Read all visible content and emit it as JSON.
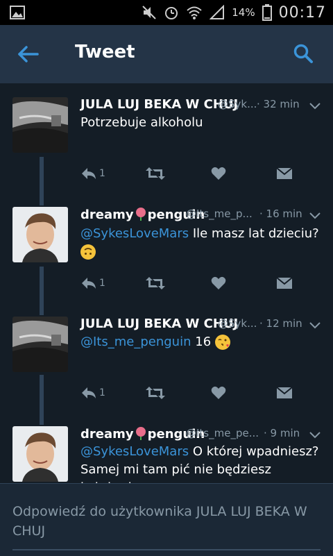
{
  "status_bar": {
    "battery": "14%",
    "time": "00:17"
  },
  "app_bar": {
    "title": "Tweet"
  },
  "tweets": [
    {
      "name": "JULA LUJ BEKA W CHUJ",
      "handle": "@Syk...",
      "time": "32 min",
      "text": "Potrzebuje alkoholu",
      "mention": "",
      "reply_count": "1"
    },
    {
      "name_before": "dreamy",
      "name_after": "penguin",
      "handle": "@Its_me_p...",
      "time": "16 min",
      "mention": "@SykesLoveMars",
      "text": " Ile masz lat dzieciu?",
      "emoji": "upside-down-face",
      "reply_count": "1"
    },
    {
      "name": "JULA LUJ BEKA W CHUJ",
      "handle": "@Syk...",
      "time": "12 min",
      "mention": "@Its_me_penguin",
      "text": " 16",
      "emoji": "kissing-face",
      "reply_count": "1"
    },
    {
      "name_before": "dreamy",
      "name_after": "penguin",
      "handle": "@Its_me_pe...",
      "time": "9 min",
      "mention": "@SykesLoveMars",
      "text": " O której wpadniesz? Samej mi tam pić nie będziesz koleżanko"
    }
  ],
  "composer": {
    "placeholder": "Odpowiedź do użytkownika JULA LUJ BEKA W CHUJ"
  },
  "colors": {
    "background": "#141d26",
    "app_bar": "#243447",
    "accent": "#3b94d9",
    "muted": "#8899a6"
  }
}
